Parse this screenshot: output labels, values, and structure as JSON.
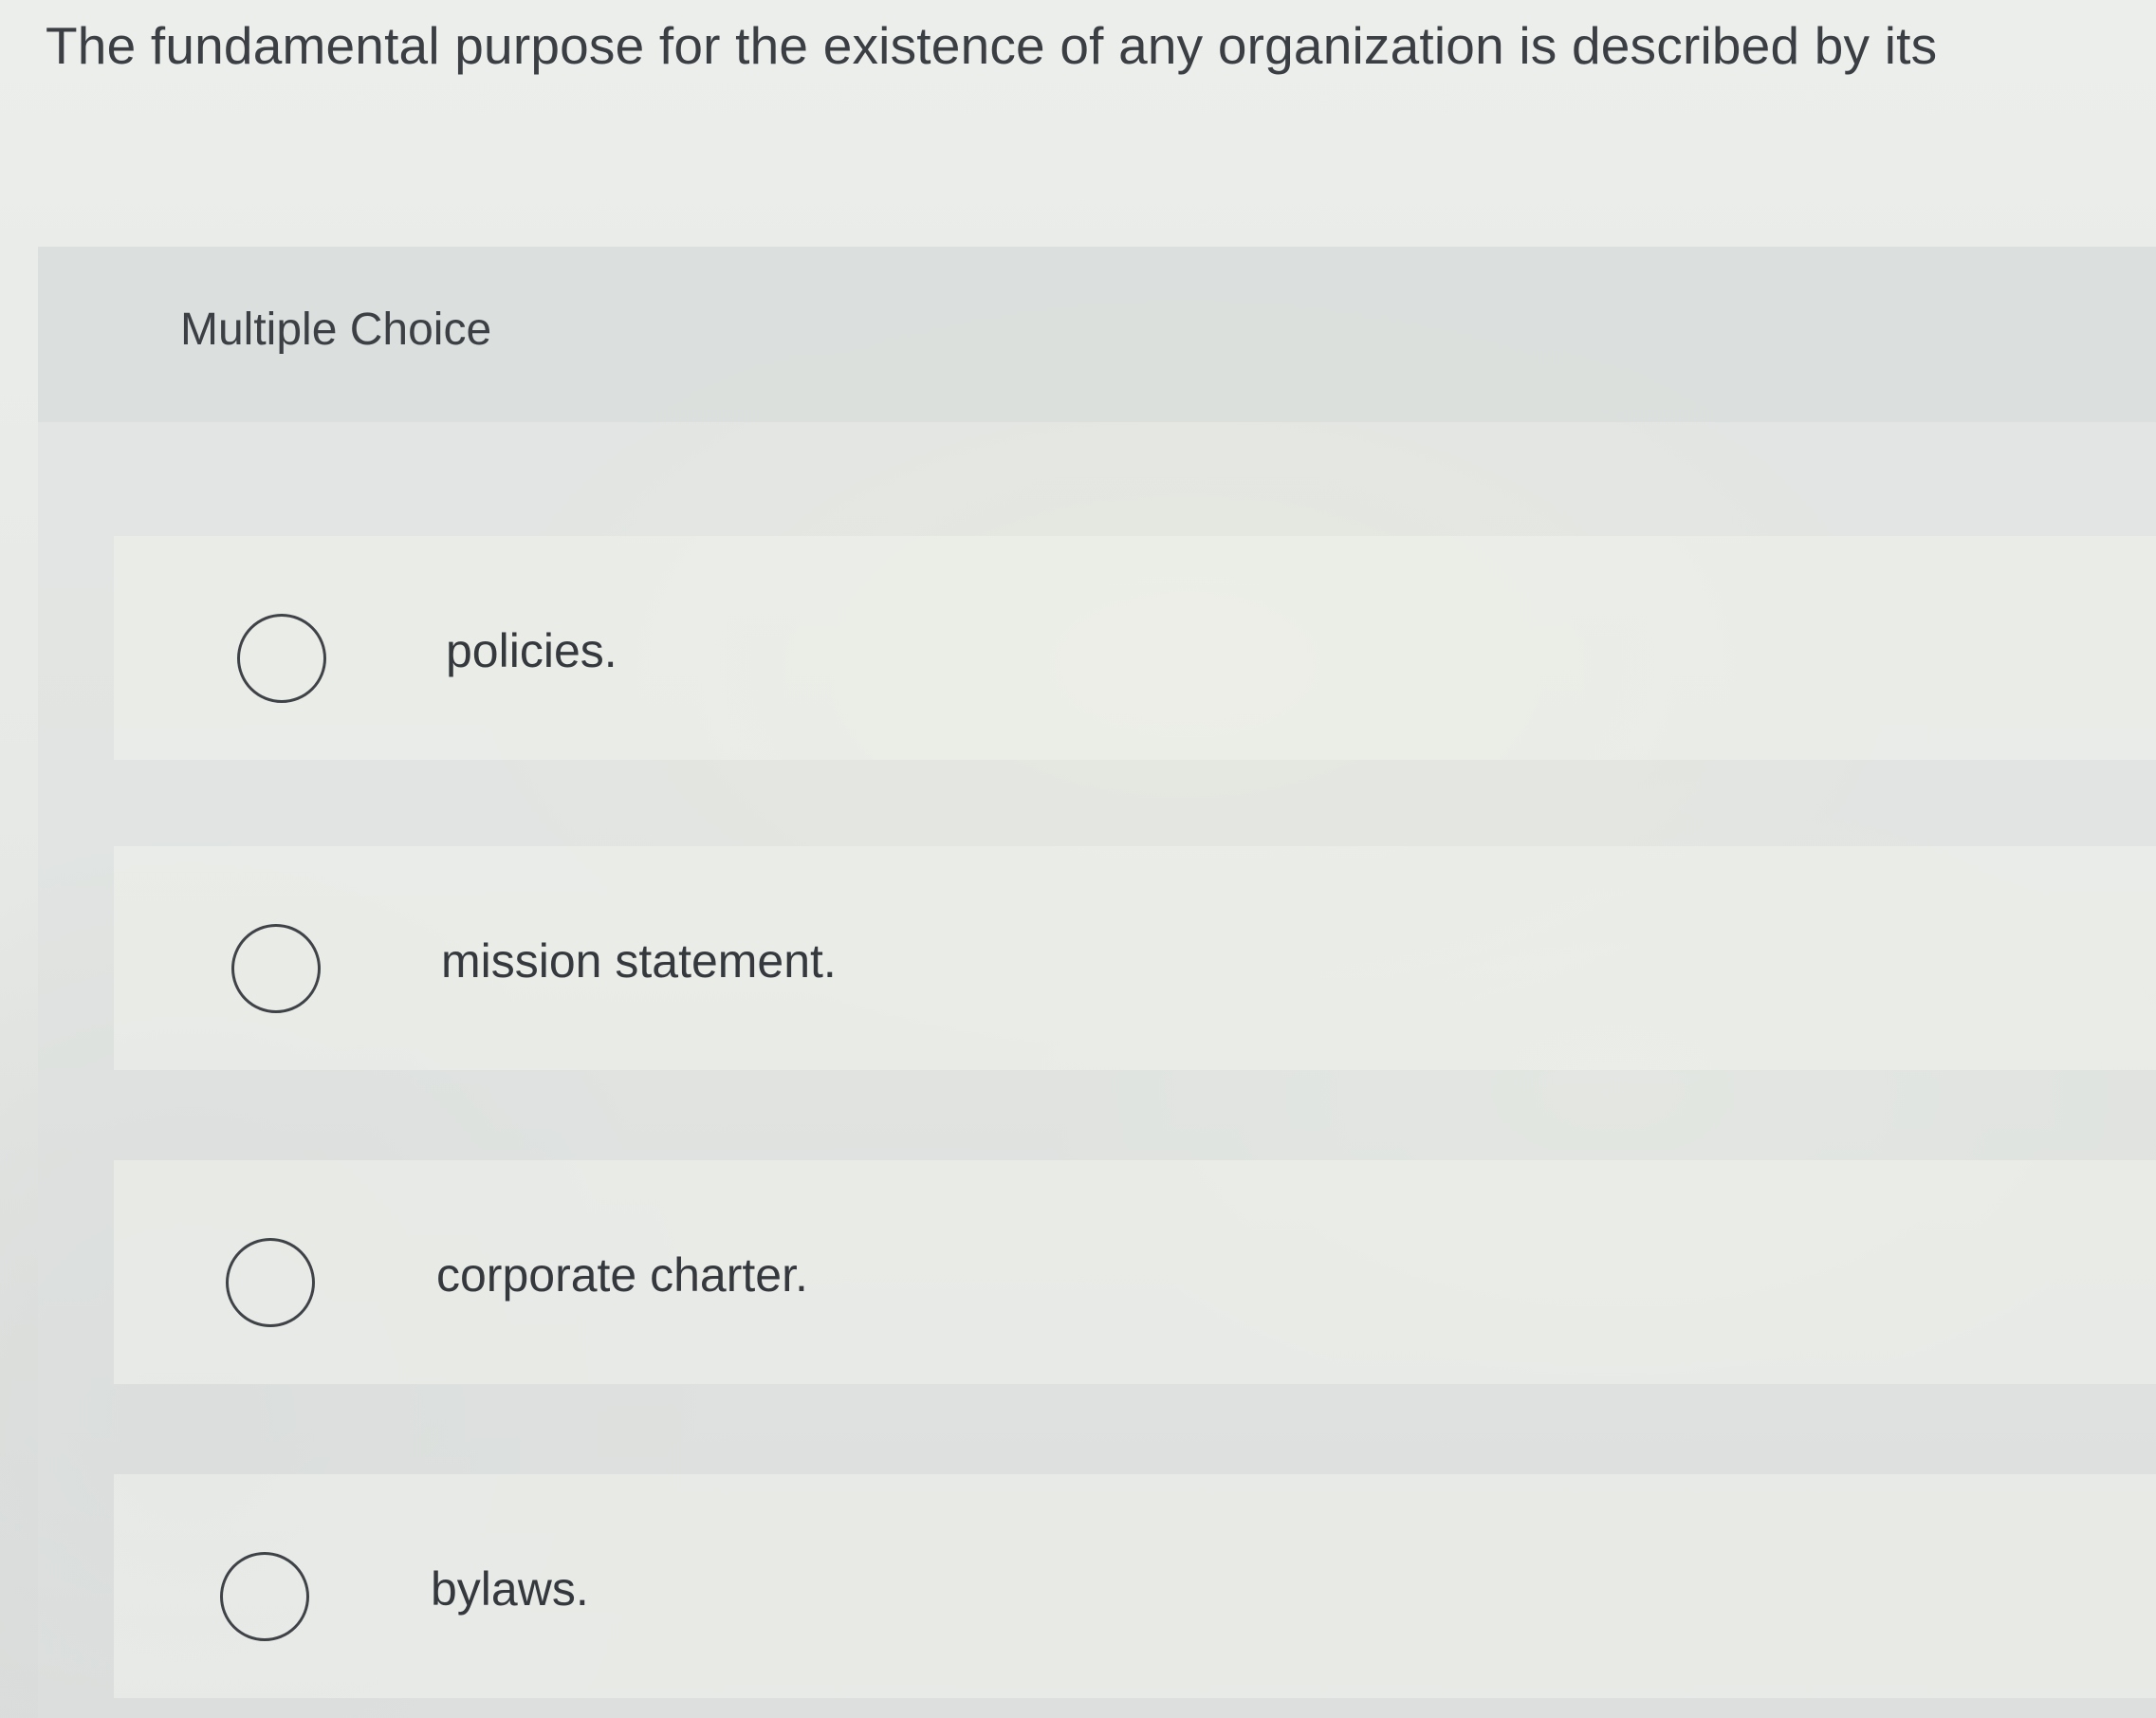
{
  "question": {
    "text": "The fundamental purpose for the existence of any organization is described by its"
  },
  "question_type": {
    "label": "Multiple Choice"
  },
  "options": [
    {
      "label": "policies.",
      "selected": false
    },
    {
      "label": "mission statement.",
      "selected": false
    },
    {
      "label": "corporate charter.",
      "selected": false
    },
    {
      "label": "bylaws.",
      "selected": false
    }
  ],
  "colors": {
    "text": "#3b3e43",
    "background": "#e9ebea",
    "radio_border": "#3f4246"
  }
}
